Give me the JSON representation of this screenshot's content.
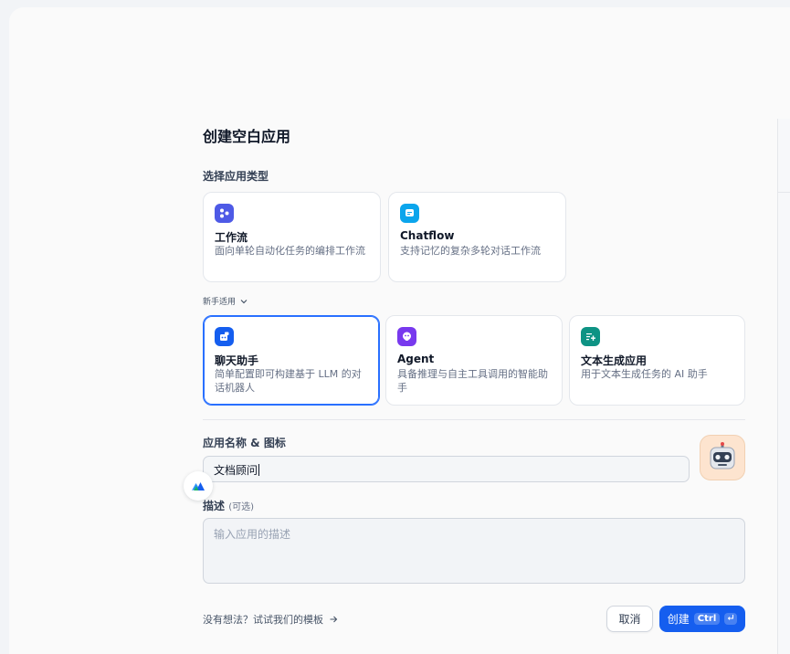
{
  "dialog": {
    "title": "创建空白应用",
    "type_section_label": "选择应用类型",
    "types": [
      {
        "name": "工作流",
        "desc": "面向单轮自动化任务的编排工作流",
        "icon": "workflow-icon",
        "color": "#4e5ae6"
      },
      {
        "name": "Chatflow",
        "desc": "支持记忆的复杂多轮对话工作流",
        "icon": "chatflow-icon",
        "color": "#0ba5ec"
      }
    ],
    "beginner_toggle": "新手适用",
    "beginner_types": [
      {
        "name": "聊天助手",
        "desc": "简单配置即可构建基于 LLM 的对话机器人",
        "icon": "chat-assistant-icon",
        "color": "#155eef",
        "selected": true
      },
      {
        "name": "Agent",
        "desc": "具备推理与自主工具调用的智能助手",
        "icon": "agent-icon",
        "color": "#7839ee"
      },
      {
        "name": "文本生成应用",
        "desc": "用于文本生成任务的 AI 助手",
        "icon": "text-generator-icon",
        "color": "#0e9384"
      }
    ],
    "name_label": "应用名称 & 图标",
    "name_value": "文档顾问",
    "app_icon": "robot-emoji-icon",
    "desc_label": "描述",
    "desc_optional": "(可选)",
    "desc_placeholder": "输入应用的描述",
    "template_link": "没有想法？试试我们的模板",
    "cancel_label": "取消",
    "create_label": "创建",
    "create_shortcut": "Ctrl"
  }
}
